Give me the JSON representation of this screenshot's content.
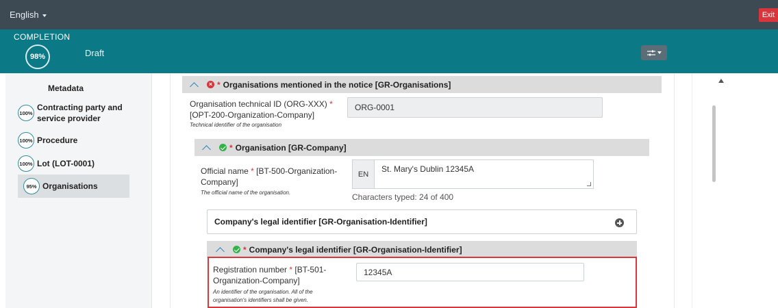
{
  "topbar": {
    "language": "English",
    "exit_label": "Exit"
  },
  "completion": {
    "label": "COMPLETION",
    "percent": "98%",
    "status": "Draft"
  },
  "sidebar": {
    "title": "Metadata",
    "items": [
      {
        "percent": "100%",
        "label": "Contracting party and service provider"
      },
      {
        "percent": "100%",
        "label": "Procedure"
      },
      {
        "percent": "100%",
        "label": "Lot (LOT-0001)"
      },
      {
        "percent": "95%",
        "label": "Organisations"
      }
    ]
  },
  "organisations_group": {
    "title": "Organisations mentioned in the notice  [GR-Organisations]",
    "tech_id": {
      "label_1": "Organisation technical ID (ORG-XXX)",
      "label_2": "[OPT-200-Organization-Company]",
      "hint": "Technical identifier of the organisation",
      "value": "ORG-0001"
    }
  },
  "company_group": {
    "title": "Organisation  [GR-Company]",
    "official_name": {
      "label_1": "Official name",
      "label_1b": " [BT-500-Organization-",
      "label_2": "Company]",
      "hint": "The official name of the organisation.",
      "lang": "EN",
      "value": "St. Mary's Dublin 12345A",
      "counter": "Characters typed: 24 of 400"
    }
  },
  "legal_id_collapsed": {
    "title": "Company's legal identifier  [GR-Organisation-Identifier]"
  },
  "legal_id_group": {
    "title": "Company's legal identifier  [GR-Organisation-Identifier]",
    "registration": {
      "label_1": "Registration number",
      "label_1b": " [BT-501-",
      "label_2": "Organization-Company]",
      "hint_1": "An identifier of the organisation. All of the",
      "hint_2": "organisation's identifiers shall be given.",
      "value": "12345A"
    }
  },
  "colors": {
    "topbar": "#3d4a54",
    "completion": "#0c7a86",
    "exit": "#d9353c",
    "required": "#d9353c",
    "valid": "#34b24a"
  }
}
